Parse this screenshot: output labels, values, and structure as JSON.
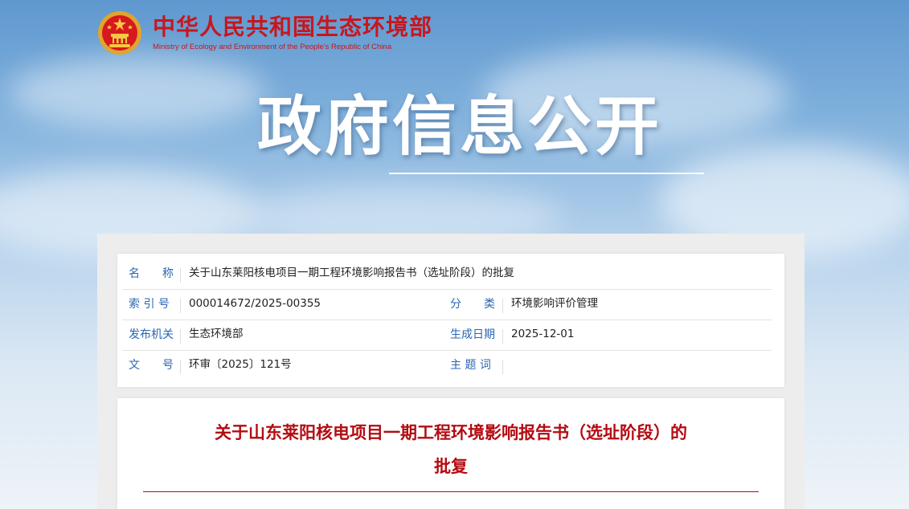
{
  "header": {
    "ministry_cn": "中华人民共和国生态环境部",
    "ministry_en": "Ministry of Ecology and Environment of the People's Republic of China",
    "emblem_icon": "national-emblem-icon"
  },
  "banner": {
    "title": "政府信息公开"
  },
  "meta": {
    "name_label": "名　　称",
    "name_value": "关于山东莱阳核电项目一期工程环境影响报告书（选址阶段）的批复",
    "index_label": "索 引 号",
    "index_value": "000014672/2025-00355",
    "category_label": "分　　类",
    "category_value": "环境影响评价管理",
    "issuer_label": "发布机关",
    "issuer_value": "生态环境部",
    "date_label": "生成日期",
    "date_value": "2025-12-01",
    "docno_label": "文　　号",
    "docno_value": "环审〔2025〕121号",
    "keywords_label": "主 题 词",
    "keywords_value": ""
  },
  "document": {
    "title_line1": "关于山东莱阳核电项目一期工程环境影响报告书（选址阶段）的",
    "title_line2": "批复"
  },
  "colors": {
    "brand_red": "#c8161d",
    "label_blue": "#2a67b3",
    "title_red": "#b30c12"
  }
}
